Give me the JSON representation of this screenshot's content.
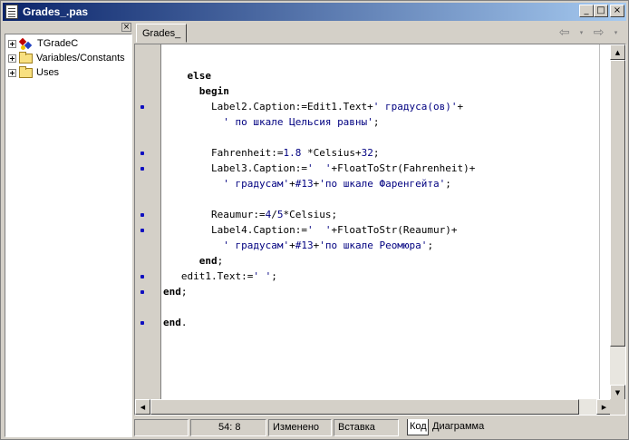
{
  "window": {
    "title": "Grades_.pas"
  },
  "title_controls": {
    "minimize": "_",
    "maximize": "□",
    "close": "×"
  },
  "explorer": {
    "close_glyph": "×",
    "items": [
      {
        "label": "TGradeC",
        "icon": "class-icon"
      },
      {
        "label": "Variables/Constants",
        "icon": "folder-icon"
      },
      {
        "label": "Uses",
        "icon": "folder-icon"
      }
    ]
  },
  "editor": {
    "tab": "Grades_",
    "nav": {
      "back": "⇦",
      "forward": "⇨",
      "dropdown": "▾"
    },
    "lines": [
      {
        "indent": "    ",
        "parts": [
          {
            "t": "else",
            "c": "kw"
          }
        ],
        "dot": false
      },
      {
        "indent": "      ",
        "parts": [
          {
            "t": "begin",
            "c": "kw"
          }
        ],
        "dot": false
      },
      {
        "indent": "        ",
        "parts": [
          {
            "t": "Label2.Caption:=Edit1.Text+",
            "c": ""
          },
          {
            "t": "' градуса(ов)'",
            "c": "str"
          },
          {
            "t": "+",
            "c": ""
          }
        ],
        "dot": true
      },
      {
        "indent": "          ",
        "parts": [
          {
            "t": "' по шкале Цельсия равны'",
            "c": "str"
          },
          {
            "t": ";",
            "c": ""
          }
        ],
        "dot": false
      },
      {
        "indent": "",
        "parts": [],
        "dot": false
      },
      {
        "indent": "        ",
        "parts": [
          {
            "t": "Fahrenheit:=",
            "c": ""
          },
          {
            "t": "1.8",
            "c": "num"
          },
          {
            "t": " *Celsius+",
            "c": ""
          },
          {
            "t": "32",
            "c": "num"
          },
          {
            "t": ";",
            "c": ""
          }
        ],
        "dot": true
      },
      {
        "indent": "        ",
        "parts": [
          {
            "t": "Label3.Caption:=",
            "c": ""
          },
          {
            "t": "'  '",
            "c": "str"
          },
          {
            "t": "+FloatToStr(Fahrenheit)+",
            "c": ""
          }
        ],
        "dot": true
      },
      {
        "indent": "          ",
        "parts": [
          {
            "t": "' градусам'",
            "c": "str"
          },
          {
            "t": "+",
            "c": ""
          },
          {
            "t": "#13",
            "c": "str"
          },
          {
            "t": "+",
            "c": ""
          },
          {
            "t": "'по шкале Фаренгейта'",
            "c": "str"
          },
          {
            "t": ";",
            "c": ""
          }
        ],
        "dot": false
      },
      {
        "indent": "",
        "parts": [],
        "dot": false
      },
      {
        "indent": "        ",
        "parts": [
          {
            "t": "Reaumur:=",
            "c": ""
          },
          {
            "t": "4",
            "c": "num"
          },
          {
            "t": "/",
            "c": ""
          },
          {
            "t": "5",
            "c": "num"
          },
          {
            "t": "*Celsius;",
            "c": ""
          }
        ],
        "dot": true
      },
      {
        "indent": "        ",
        "parts": [
          {
            "t": "Label4.Caption:=",
            "c": ""
          },
          {
            "t": "'  '",
            "c": "str"
          },
          {
            "t": "+FloatToStr(Reaumur)+",
            "c": ""
          }
        ],
        "dot": true
      },
      {
        "indent": "          ",
        "parts": [
          {
            "t": "' градусам'",
            "c": "str"
          },
          {
            "t": "+",
            "c": ""
          },
          {
            "t": "#13",
            "c": "str"
          },
          {
            "t": "+",
            "c": ""
          },
          {
            "t": "'по шкале Реомюра'",
            "c": "str"
          },
          {
            "t": ";",
            "c": ""
          }
        ],
        "dot": false
      },
      {
        "indent": "      ",
        "parts": [
          {
            "t": "end",
            "c": "kw"
          },
          {
            "t": ";",
            "c": ""
          }
        ],
        "dot": false
      },
      {
        "indent": "   ",
        "parts": [
          {
            "t": "edit1.Text:=",
            "c": ""
          },
          {
            "t": "' '",
            "c": "str"
          },
          {
            "t": ";",
            "c": ""
          }
        ],
        "dot": true
      },
      {
        "indent": "",
        "parts": [
          {
            "t": "end",
            "c": "kw"
          },
          {
            "t": ";",
            "c": ""
          }
        ],
        "dot": true
      },
      {
        "indent": "",
        "parts": [],
        "dot": false
      },
      {
        "indent": "",
        "parts": [
          {
            "t": "end",
            "c": "kw"
          },
          {
            "t": ".",
            "c": ""
          }
        ],
        "dot": true
      }
    ]
  },
  "status": {
    "position": "54:  8",
    "modified": "Изменено",
    "insert_mode": "Вставка",
    "tabs": [
      "Код",
      "Диаграмма"
    ]
  },
  "colors": {
    "titlebar_start": "#0a246a",
    "titlebar_end": "#a6caf0",
    "string": "#000080",
    "breakpoint_dot": "#1010c0"
  }
}
